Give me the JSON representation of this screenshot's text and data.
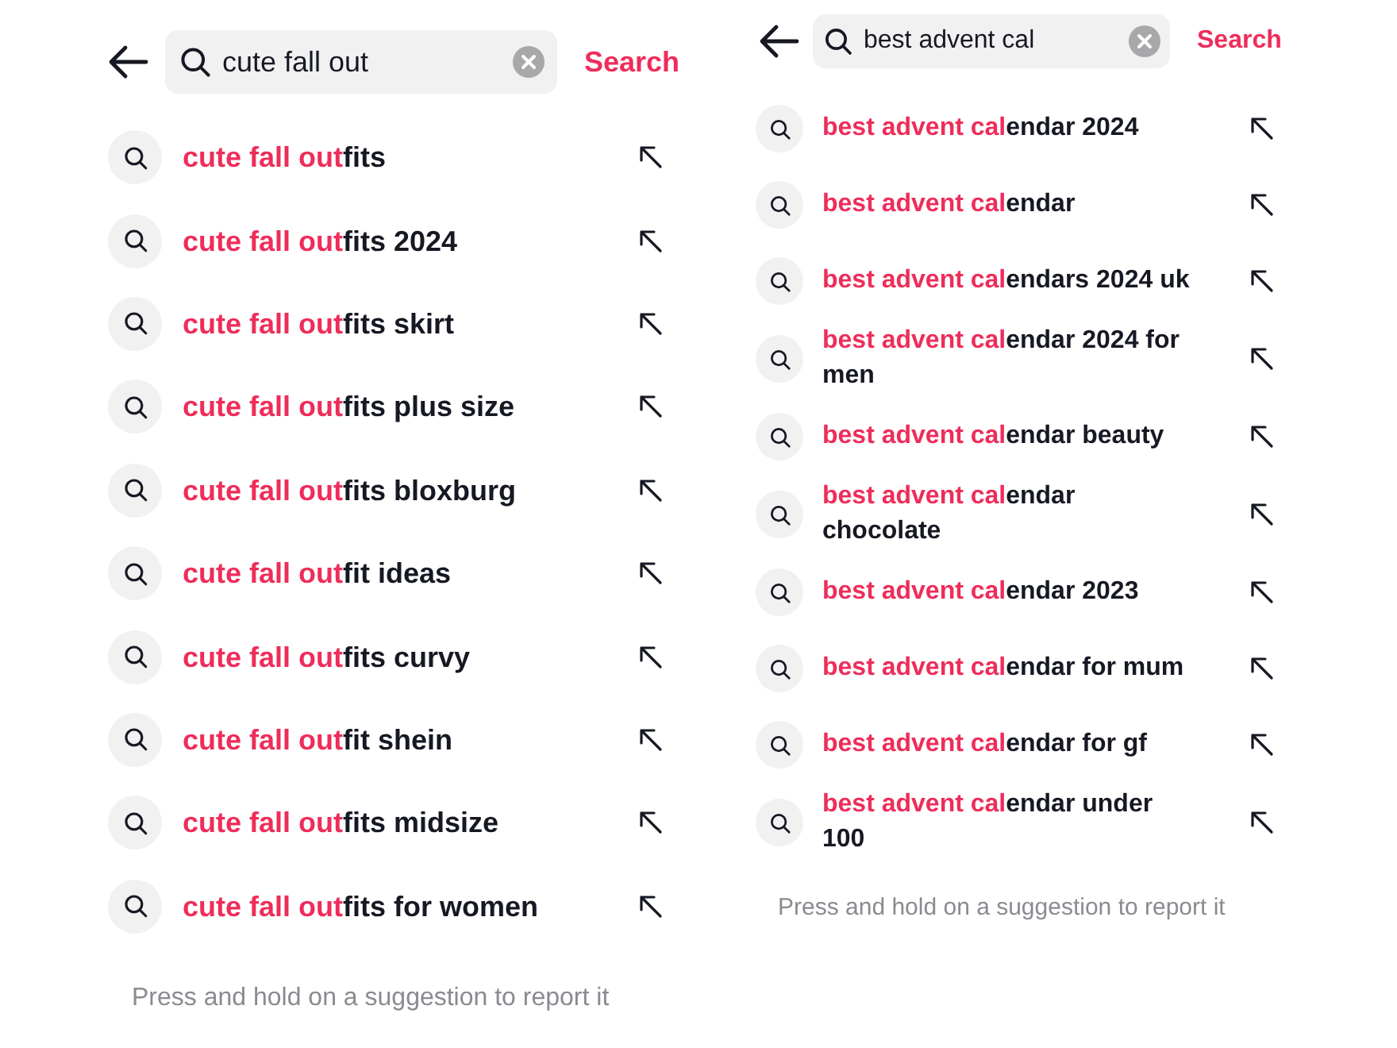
{
  "panels": [
    {
      "search": {
        "value": "cute fall out",
        "button": "Search"
      },
      "suggestions": [
        {
          "match": "cute fall out",
          "rest": "fits"
        },
        {
          "match": "cute fall out",
          "rest": "fits 2024"
        },
        {
          "match": "cute fall out",
          "rest": "fits skirt"
        },
        {
          "match": "cute fall out",
          "rest": "fits plus size"
        },
        {
          "match": "cute fall out",
          "rest": "fits bloxburg"
        },
        {
          "match": "cute fall out",
          "rest": "fit ideas"
        },
        {
          "match": "cute fall out",
          "rest": "fits curvy"
        },
        {
          "match": "cute fall out",
          "rest": "fit shein"
        },
        {
          "match": "cute fall out",
          "rest": "fits midsize"
        },
        {
          "match": "cute fall out",
          "rest": "fits for women"
        }
      ],
      "footer": "Press and hold on a suggestion to report it"
    },
    {
      "search": {
        "value": "best advent cal",
        "button": "Search"
      },
      "suggestions": [
        {
          "match": "best advent cal",
          "rest": "endar 2024"
        },
        {
          "match": "best advent cal",
          "rest": "endar"
        },
        {
          "match": "best advent cal",
          "rest": "endars 2024 uk"
        },
        {
          "match": "best advent cal",
          "rest": "endar 2024 for men"
        },
        {
          "match": "best advent cal",
          "rest": "endar beauty"
        },
        {
          "match": "best advent cal",
          "rest": "endar chocolate"
        },
        {
          "match": "best advent cal",
          "rest": "endar 2023"
        },
        {
          "match": "best advent cal",
          "rest": "endar for mum"
        },
        {
          "match": "best advent cal",
          "rest": "endar for gf"
        },
        {
          "match": "best advent cal",
          "rest": "endar under 100"
        }
      ],
      "footer": "Press and hold on a suggestion to report it"
    }
  ]
}
